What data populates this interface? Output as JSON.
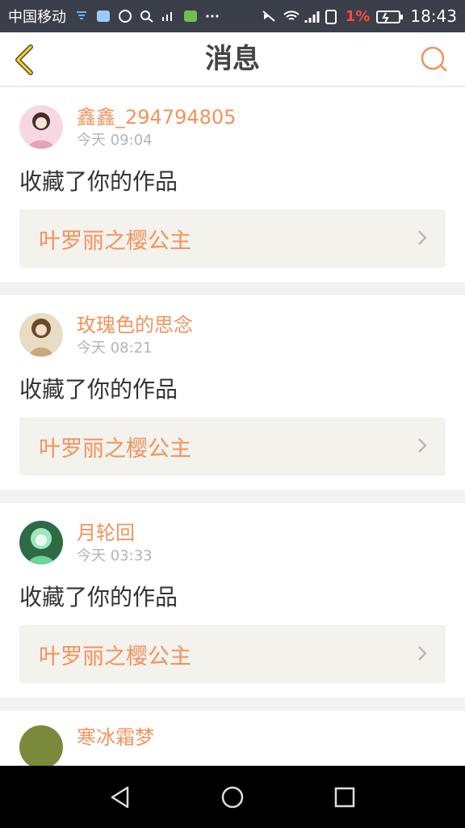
{
  "status_bar": {
    "carrier": "中国移动",
    "battery": "1%",
    "time": "18:43",
    "icons": [
      "usb-icon",
      "app-icon",
      "app-icon",
      "search-icon",
      "signal-icon",
      "app-icon",
      "more-icon",
      "mute-icon",
      "wifi-icon",
      "cell-signal-icon",
      "sim-icon",
      "battery-icon"
    ]
  },
  "header": {
    "title": "消息",
    "accent": "#f1935c"
  },
  "messages": [
    {
      "username": "鑫鑫_294794805",
      "time": "今天 09:04",
      "action": "收藏了你的作品",
      "work": "叶罗丽之樱公主",
      "avatar_color": "#e9a0b8"
    },
    {
      "username": "玫瑰色的思念",
      "time": "今天 08:21",
      "action": "收藏了你的作品",
      "work": "叶罗丽之樱公主",
      "avatar_color": "#c9a87a"
    },
    {
      "username": "月轮回",
      "time": "今天 03:33",
      "action": "收藏了你的作品",
      "work": "叶罗丽之樱公主",
      "avatar_color": "#6fd39a"
    },
    {
      "username": "寒冰霜梦",
      "avatar_color": "#7a8a3a"
    }
  ],
  "navbar": {
    "icons": [
      "back-triangle-icon",
      "home-circle-icon",
      "recents-square-icon"
    ]
  }
}
